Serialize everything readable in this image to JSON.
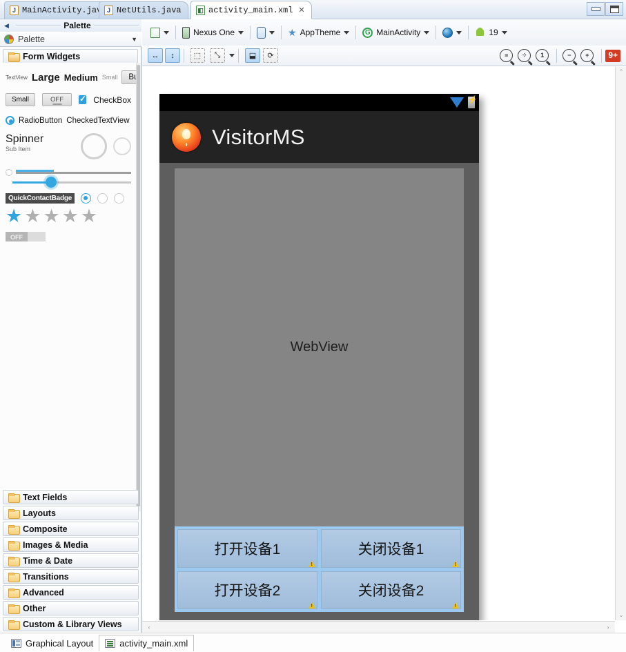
{
  "window": {
    "minimize_label": "Minimize",
    "maximize_label": "Maximize"
  },
  "editor_tabs": [
    {
      "label": "MainActivity.java",
      "icon": "java-file-icon",
      "active": false,
      "closable": false
    },
    {
      "label": "NetUtils.java",
      "icon": "java-file-icon",
      "active": false,
      "closable": false
    },
    {
      "label": "activity_main.xml",
      "icon": "xml-file-icon",
      "active": true,
      "closable": true,
      "close_glyph": "✕"
    }
  ],
  "palette": {
    "title": "Palette",
    "header_label": "Palette",
    "collapse_arrow": "◀",
    "chevron": "▼",
    "group": {
      "label": "Form Widgets",
      "icon": "open-folder-icon"
    },
    "widgets": {
      "textview": "TextView",
      "large": "Large",
      "medium": "Medium",
      "small": "Small",
      "button": "Button",
      "small_button": "Small",
      "off_button": "OFF",
      "checkbox": "CheckBox",
      "radiobutton": "RadioButton",
      "checkedtextview": "CheckedTextView",
      "spinner": "Spinner",
      "spinner_sub": "Sub Item",
      "quickcontactbadge": "QuickContactBadge",
      "switch_off": "OFF"
    },
    "categories": [
      {
        "label": "Text Fields",
        "icon": "folder-icon"
      },
      {
        "label": "Layouts",
        "icon": "folder-icon"
      },
      {
        "label": "Composite",
        "icon": "folder-icon"
      },
      {
        "label": "Images & Media",
        "icon": "folder-icon"
      },
      {
        "label": "Time & Date",
        "icon": "folder-icon"
      },
      {
        "label": "Transitions",
        "icon": "folder-icon"
      },
      {
        "label": "Advanced",
        "icon": "folder-icon"
      },
      {
        "label": "Other",
        "icon": "folder-icon"
      },
      {
        "label": "Custom & Library Views",
        "icon": "folder-icon"
      }
    ]
  },
  "toolbar_primary": [
    {
      "name": "config-chooser",
      "label": "",
      "icon": "xml-config-icon",
      "has_caret": true
    },
    {
      "name": "device-chooser",
      "label": "Nexus One",
      "icon": "device-phone-icon",
      "has_caret": true
    },
    {
      "name": "orientation-chooser",
      "label": "",
      "icon": "rotate-device-icon",
      "has_caret": true
    },
    {
      "name": "theme-chooser",
      "label": "AppTheme",
      "icon": "star-icon",
      "has_caret": true
    },
    {
      "name": "activity-chooser",
      "label": "MainActivity",
      "icon": "activity-icon",
      "has_caret": true
    },
    {
      "name": "locale-chooser",
      "label": "",
      "icon": "globe-icon",
      "has_caret": true
    },
    {
      "name": "api-level-chooser",
      "label": "19",
      "icon": "android-icon",
      "has_caret": true
    }
  ],
  "toolbar_secondary": {
    "left_buttons": [
      {
        "name": "toggle-width-fill",
        "icon": "horizontal-arrows-icon",
        "glyph": "↔",
        "active": true
      },
      {
        "name": "toggle-height-fill",
        "icon": "vertical-arrows-icon",
        "glyph": "↕",
        "active": true
      },
      {
        "name": "margins-toggle",
        "icon": "dotted-box-icon",
        "glyph": "⬚",
        "active": false
      },
      {
        "name": "distribute-toggle",
        "icon": "expand-box-icon",
        "glyph": "⤡",
        "active": false,
        "has_caret": true
      },
      {
        "name": "show-included-toggle",
        "icon": "include-layout-icon",
        "glyph": "⬓",
        "active": true
      },
      {
        "name": "refresh-render-toggle",
        "icon": "refresh-layout-icon",
        "glyph": "⟳",
        "active": false
      }
    ],
    "right_buttons": [
      {
        "name": "zoom-fit",
        "icon": "zoom-fit-icon",
        "glyph": "≡"
      },
      {
        "name": "zoom-fit-selection",
        "icon": "zoom-selection-icon",
        "glyph": "⁘"
      },
      {
        "name": "zoom-actual-size",
        "icon": "zoom-100-icon",
        "glyph": "1"
      },
      {
        "name": "zoom-out",
        "icon": "zoom-out-icon",
        "glyph": "−"
      },
      {
        "name": "zoom-in",
        "icon": "zoom-in-icon",
        "glyph": "+"
      }
    ],
    "notification_badge": "9+"
  },
  "device_preview": {
    "app_title": "VisitorMS",
    "app_icon": "lightbulb-app-icon",
    "status_icons": [
      "wifi-signal-icon",
      "battery-charging-icon"
    ],
    "webview_label": "WebView",
    "buttons": [
      {
        "label": "打开设备1",
        "warning": true
      },
      {
        "label": "关闭设备1",
        "warning": true
      },
      {
        "label": "打开设备2",
        "warning": true
      },
      {
        "label": "关闭设备2",
        "warning": true
      }
    ]
  },
  "scrollbars": {
    "v_up": "⌃",
    "v_down": "⌄",
    "h_left": "‹",
    "h_right": "›"
  },
  "bottom_tabs": [
    {
      "label": "Graphical Layout",
      "icon": "graphical-layout-icon",
      "active": false
    },
    {
      "label": "activity_main.xml",
      "icon": "xml-source-icon",
      "active": true
    }
  ]
}
